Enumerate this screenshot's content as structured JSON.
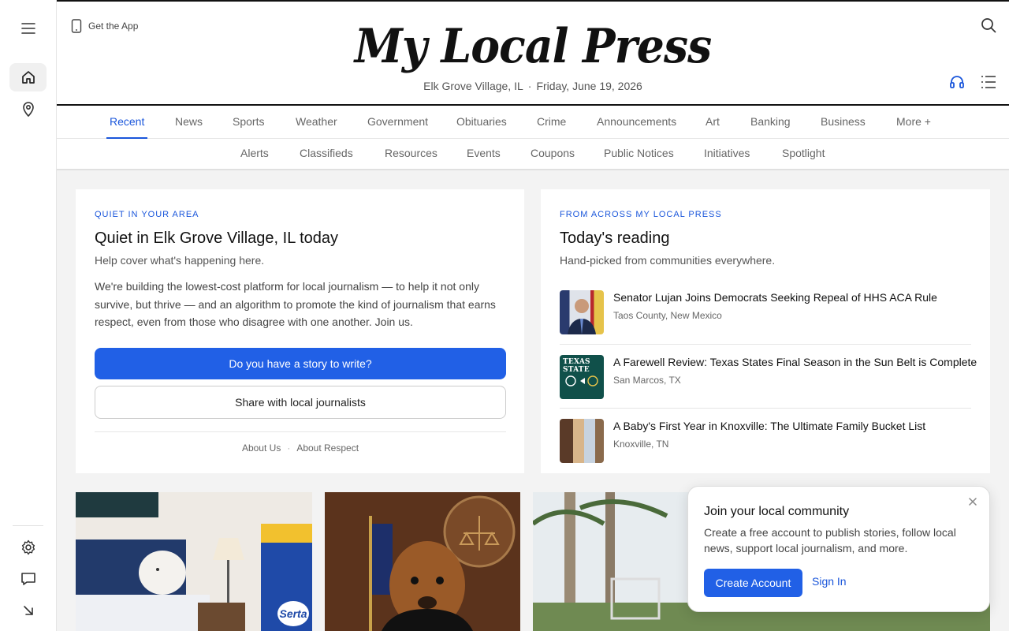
{
  "header": {
    "get_app": "Get the App",
    "masthead": "My Local Press",
    "location": "Elk Grove Village, IL",
    "separator": "·",
    "date": "Friday, June 19, 2026"
  },
  "nav": {
    "primary": [
      {
        "label": "Recent",
        "active": true
      },
      {
        "label": "News"
      },
      {
        "label": "Sports"
      },
      {
        "label": "Weather"
      },
      {
        "label": "Government"
      },
      {
        "label": "Obituaries"
      },
      {
        "label": "Crime"
      },
      {
        "label": "Announcements"
      },
      {
        "label": "Art"
      },
      {
        "label": "Banking"
      },
      {
        "label": "Business"
      },
      {
        "label": "More +"
      }
    ],
    "secondary": [
      {
        "label": "Alerts"
      },
      {
        "label": "Classifieds"
      },
      {
        "label": "Resources"
      },
      {
        "label": "Events"
      },
      {
        "label": "Coupons"
      },
      {
        "label": "Public Notices"
      },
      {
        "label": "Initiatives"
      },
      {
        "label": "Spotlight"
      }
    ]
  },
  "left_card": {
    "eyebrow": "QUIET IN YOUR AREA",
    "title": "Quiet in Elk Grove Village, IL today",
    "subtitle": "Help cover what's happening here.",
    "body": "We're building the lowest-cost platform for local journalism — to help it not only survive, but thrive — and an algorithm to promote the kind of journalism that earns respect, even from those who disagree with one another. Join us.",
    "primary_button": "Do you have a story to write?",
    "secondary_button": "Share with local journalists",
    "link_about_us": "About Us",
    "link_sep": "·",
    "link_about_respect": "About Respect"
  },
  "right_card": {
    "eyebrow": "FROM ACROSS MY LOCAL PRESS",
    "title": "Today's reading",
    "subtitle": "Hand-picked from communities everywhere.",
    "stories": [
      {
        "title": "Senator Lujan Joins Democrats Seeking Repeal of HHS ACA Rule",
        "location": "Taos County, New Mexico"
      },
      {
        "title": "A Farewell Review: Texas States Final Season in the Sun Belt is Complete",
        "location": "San Marcos, TX",
        "thumb_text": "TEXAS STATE"
      },
      {
        "title": "A Baby's First Year in Knoxville: The Ultimate Family Bucket List",
        "location": "Knoxville, TN"
      }
    ]
  },
  "tiles": {
    "serta_text": "Serta"
  },
  "popup": {
    "title": "Join your local community",
    "text": "Create a free account to publish stories, follow local news, support local journalism, and more.",
    "create_button": "Create Account",
    "sign_in": "Sign In"
  },
  "colors": {
    "accent": "#2160e6",
    "link": "#1a56db",
    "background": "#f3f3f3"
  },
  "icons": {
    "rail": [
      "menu-icon",
      "home-icon",
      "location-pin-icon",
      "settings-icon",
      "chat-icon",
      "collapse-arrow-icon"
    ],
    "header": [
      "phone-icon",
      "search-icon",
      "headphones-icon",
      "list-icon"
    ]
  }
}
